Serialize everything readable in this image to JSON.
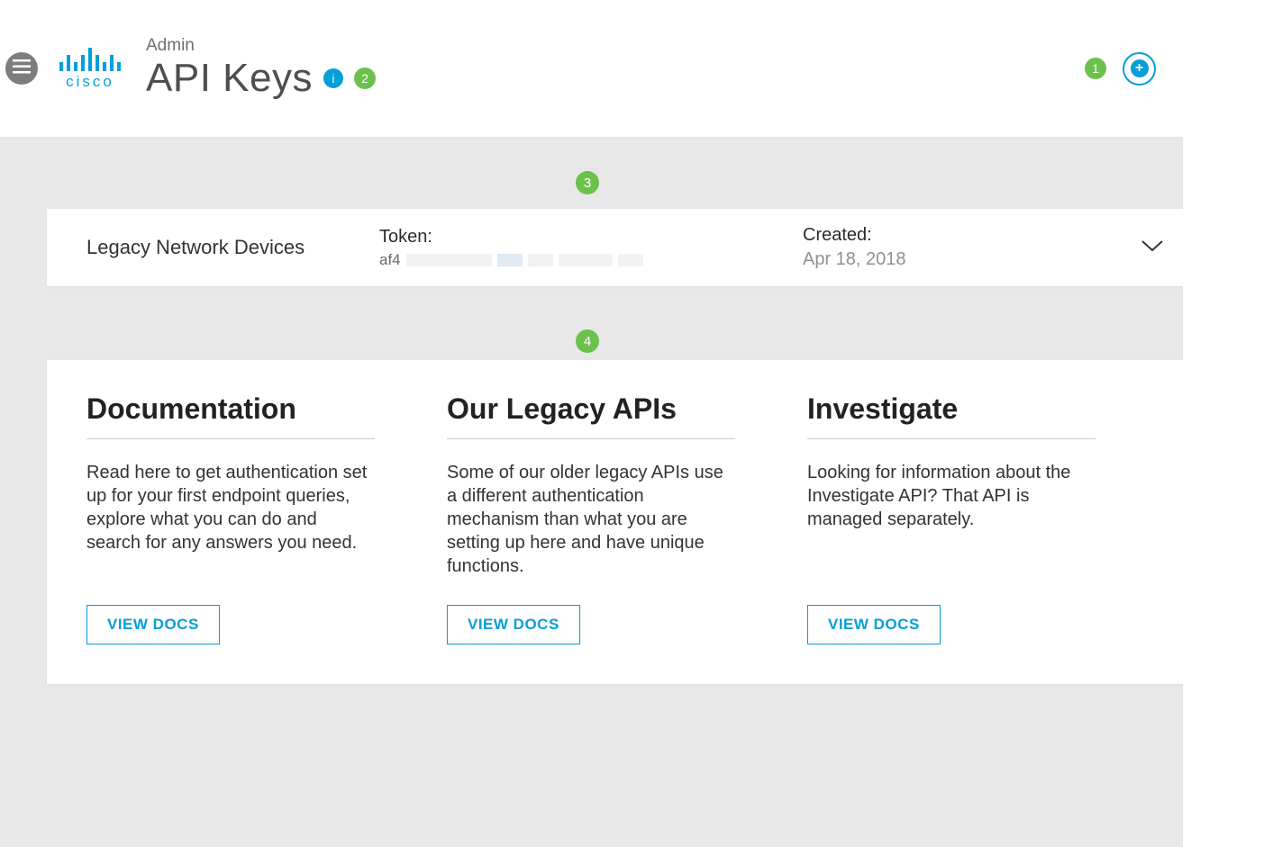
{
  "header": {
    "breadcrumb": "Admin",
    "title": "API Keys",
    "badge2": "2",
    "badge1": "1"
  },
  "callouts": {
    "c3": "3",
    "c4": "4"
  },
  "key_row": {
    "name": "Legacy Network Devices",
    "token_label": "Token:",
    "token_prefix": "af4",
    "created_label": "Created:",
    "created_value": "Apr 18, 2018"
  },
  "docs": [
    {
      "title": "Documentation",
      "body": "Read here to get authentication set up for your first endpoint queries, explore what you can do and search for any answers you need.",
      "cta": "VIEW DOCS"
    },
    {
      "title": "Our Legacy APIs",
      "body": "Some of our older legacy APIs use a different authentication mechanism than what you are setting up here and have unique functions.",
      "cta": "VIEW DOCS"
    },
    {
      "title": "Investigate",
      "body": "Looking for information about the Investigate API? That API is managed separately.",
      "cta": "VIEW DOCS"
    }
  ]
}
